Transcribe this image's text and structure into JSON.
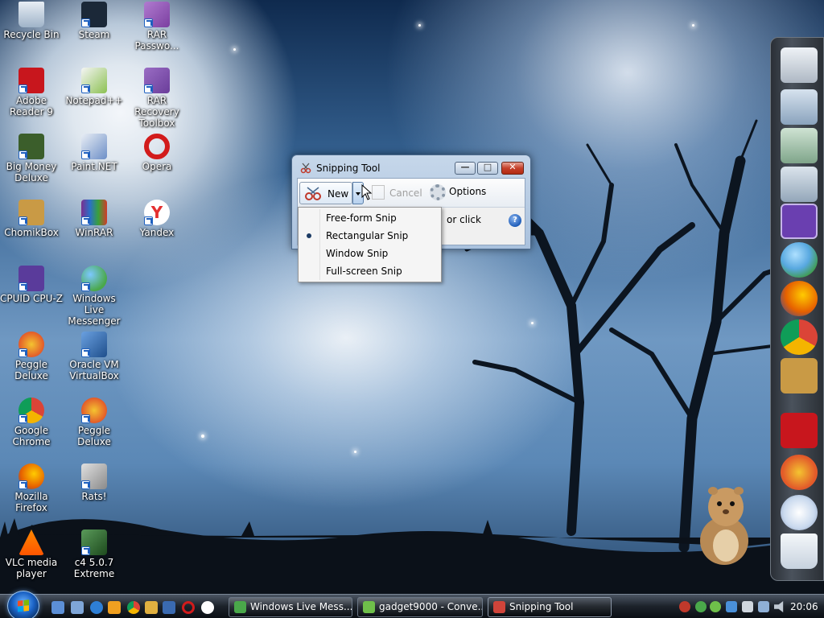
{
  "desktop": {
    "icons": [
      {
        "label": "Recycle Bin",
        "color": "#9fb3c8"
      },
      {
        "label": "Steam",
        "color": "#1b2838"
      },
      {
        "label": "RAR Passwo...",
        "color": "#7b3fa0"
      },
      {
        "label": "Adobe Reader 9",
        "color": "#c8161d"
      },
      {
        "label": "Notepad++",
        "color": "#8cc152"
      },
      {
        "label": "RAR Recovery Toolbox",
        "color": "#6a3d9a"
      },
      {
        "label": "Big Money Deluxe",
        "color": "#3b5e2b"
      },
      {
        "label": "Paint.NET",
        "color": "#e9eef5"
      },
      {
        "label": "Opera",
        "color": "#d21b1b"
      },
      {
        "label": "ChomikBox",
        "color": "#c99a45"
      },
      {
        "label": "WinRAR",
        "color": "#7b2f8e"
      },
      {
        "label": "Yandex",
        "color": "#ffffff"
      },
      {
        "label": "CPUID CPU-Z",
        "color": "#5a3b9b"
      },
      {
        "label": "Windows Live Messenger",
        "color": "#4aa84a"
      },
      {
        "label": "Peggle Deluxe",
        "color": "#e25a2a"
      },
      {
        "label": "Oracle VM VirtualBox",
        "color": "#1f4f8c"
      },
      {
        "label": "Google Chrome",
        "color": "#3b8de0"
      },
      {
        "label": "Peggle Deluxe",
        "color": "#e25a2a"
      },
      {
        "label": "Mozilla Firefox",
        "color": "#e66000"
      },
      {
        "label": "Rats!",
        "color": "#b0b0b0"
      },
      {
        "label": "VLC media player",
        "color": "#ff8800"
      },
      {
        "label": "c4 5.0.7 Extreme",
        "color": "#2d6e2d"
      }
    ]
  },
  "window": {
    "title": "Snipping Tool",
    "buttons": {
      "minimize": "—",
      "maximize": "□",
      "close": "✕"
    },
    "toolbar": {
      "new_label": "New",
      "cancel_label": "Cancel",
      "options_label": "Options"
    },
    "hint_text": "or click"
  },
  "menu": {
    "items": [
      {
        "label": "Free-form Snip",
        "selected": false
      },
      {
        "label": "Rectangular Snip",
        "selected": true
      },
      {
        "label": "Window Snip",
        "selected": false
      },
      {
        "label": "Full-screen Snip",
        "selected": false
      }
    ]
  },
  "dock": {
    "items": [
      {
        "name": "computer-icon",
        "color": "#cfd6de"
      },
      {
        "name": "folder-icon",
        "color": "#9fb7cf"
      },
      {
        "name": "folder-green-icon",
        "color": "#8fb59a"
      },
      {
        "name": "folder-documents-icon",
        "color": "#a8b8c8"
      },
      {
        "name": "cpu-z-icon",
        "color": "#6a3fb0"
      },
      {
        "name": "messenger-icon",
        "color": "#58a8e0"
      },
      {
        "name": "firefox-icon",
        "color": "#e66000"
      },
      {
        "name": "chrome-icon",
        "color": "#3b8de0"
      },
      {
        "name": "chomikbox-icon",
        "color": "#c99a45"
      },
      {
        "name": "adobe-reader-icon",
        "color": "#c8161d"
      },
      {
        "name": "peggle-icon",
        "color": "#e25a2a"
      },
      {
        "name": "paint-icon",
        "color": "#c9d9ee"
      },
      {
        "name": "recycle-bin-icon",
        "color": "#dfe6ee"
      }
    ]
  },
  "taskbar": {
    "quick_launch": [
      {
        "name": "show-desktop-icon",
        "color": "#5c8fd6"
      },
      {
        "name": "switch-windows-icon",
        "color": "#7fa6d8"
      },
      {
        "name": "internet-explorer-icon",
        "color": "#2e7fd6"
      },
      {
        "name": "media-player-icon",
        "color": "#f0a020"
      },
      {
        "name": "chrome-icon",
        "color": "#3b8de0"
      },
      {
        "name": "folder-icon",
        "color": "#e0b040"
      },
      {
        "name": "virtualbox-icon",
        "color": "#3a6ab0"
      },
      {
        "name": "opera-icon",
        "color": "#d21b1b"
      },
      {
        "name": "yandex-icon",
        "color": "#e53030"
      }
    ],
    "tasks": [
      {
        "label": "Windows Live Mess...",
        "color": "#4aa84a",
        "active": false
      },
      {
        "label": "gadget9000 - Conve...",
        "color": "#6fbf4a",
        "active": false
      },
      {
        "label": "Snipping Tool",
        "color": "#d0443a",
        "active": true
      }
    ],
    "clock": "20:06"
  }
}
